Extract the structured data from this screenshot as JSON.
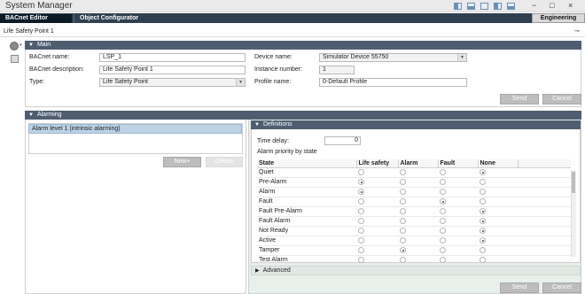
{
  "app": {
    "title": "System Manager"
  },
  "tabs": [
    {
      "label": "BACnet Editor"
    },
    {
      "label": "Object Configurator"
    }
  ],
  "workspace": {
    "label": "Engineering"
  },
  "breadcrumb": {
    "label": "Life Safety Point 1"
  },
  "main_section": {
    "title": "Main",
    "bacnet_name": {
      "label": "BACnet name:",
      "value": "LSP_1"
    },
    "bacnet_description": {
      "label": "BACnet description:",
      "value": "Life Safety Point 1"
    },
    "type": {
      "label": "Type:",
      "value": "Life Safety Point"
    },
    "device_name": {
      "label": "Device name:",
      "value": "Simulator Device 55750"
    },
    "instance_number": {
      "label": "Instance number:",
      "value": "1"
    },
    "profile_name": {
      "label": "Profile name:",
      "value": "0-Default Profile"
    },
    "send_label": "Send",
    "cancel_label": "Cancel"
  },
  "alarming_section": {
    "title": "Alarming",
    "alarm_levels": [
      "Alarm level 1 (intrinsic alarming)"
    ],
    "new_label": "New+",
    "delete_label": "Delete"
  },
  "definitions": {
    "title": "Definitions",
    "time_delay": {
      "label": "Time delay:",
      "value": "0"
    },
    "priority_caption": "Alarm priority by state",
    "columns": [
      "State",
      "Life safety",
      "Alarm",
      "Fault",
      "None"
    ],
    "rows": [
      {
        "state": "Quiet",
        "selected": 4
      },
      {
        "state": "Pre-Alarm",
        "selected": 1
      },
      {
        "state": "Alarm",
        "selected": 1
      },
      {
        "state": "Fault",
        "selected": 3
      },
      {
        "state": "Fault Pre-Alarm",
        "selected": 4
      },
      {
        "state": "Fault Alarm",
        "selected": 4
      },
      {
        "state": "Not Ready",
        "selected": 4
      },
      {
        "state": "Active",
        "selected": 4
      },
      {
        "state": "Tamper",
        "selected": 2
      },
      {
        "state": "Test Alarm",
        "selected": 0
      }
    ]
  },
  "advanced": {
    "title": "Advanced"
  },
  "footer": {
    "send_label": "Send",
    "cancel_label": "Cancel"
  },
  "colors": {
    "tabbar": "#2f4050",
    "section_header": "#4e5e70",
    "selection": "#bcd3e6"
  }
}
